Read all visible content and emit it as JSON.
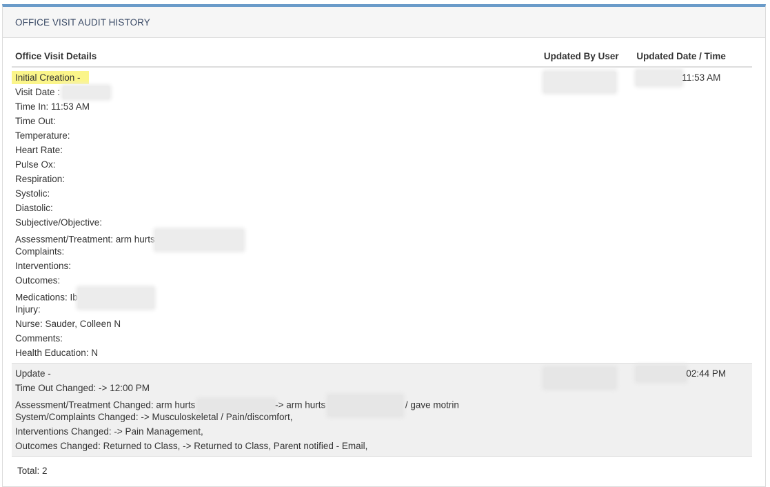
{
  "panel": {
    "title": "OFFICE VISIT AUDIT HISTORY"
  },
  "table": {
    "headers": {
      "details": "Office Visit Details",
      "user": "Updated By User",
      "date": "Updated Date / Time"
    },
    "rows": [
      {
        "lines": [
          "Initial Creation -",
          "Visit Date :",
          "Time In: 11:53 AM",
          "Time Out:",
          "Temperature:",
          "Heart Rate:",
          "Pulse Ox:",
          "Respiration:",
          "Systolic:",
          "Diastolic:",
          "Subjective/Objective:",
          "Assessment/Treatment: arm hurts",
          "Complaints:",
          "Interventions:",
          "Outcomes:",
          "Medications: Ib",
          "Injury:",
          "Nurse: Sauder, Colleen N",
          "Comments:",
          "Health Education: N"
        ],
        "time": "11:53 AM"
      },
      {
        "lines": [
          "Update -",
          "Time Out Changed: -> 12:00 PM",
          "Assessment/Treatment Changed: arm hurts",
          "-> arm hurts",
          "/ gave motrin",
          "System/Complaints Changed: -> Musculoskeletal / Pain/discomfort,",
          "Interventions Changed: -> Pain Management,",
          "Outcomes Changed: Returned to Class, -> Returned to Class, Parent notified - Email,"
        ],
        "time": "02:44 PM"
      }
    ]
  },
  "footer": {
    "total": "Total: 2"
  },
  "colors": {
    "accent_top_border": "#6a9bc9",
    "highlight": "#fbf58a",
    "update_row_bg": "#f0f0f0"
  }
}
